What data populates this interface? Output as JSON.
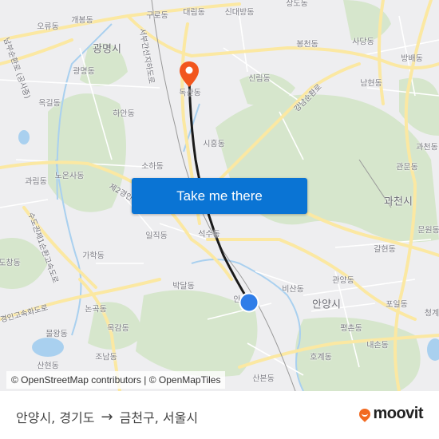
{
  "map": {
    "colors": {
      "background": "#eeeef0",
      "park": "#d6e6cc",
      "major_road": "#fbe8a2",
      "minor_road": "#ffffff",
      "water": "#a9d0ef",
      "route_line": "#1a1a1a",
      "destination_pin": "#f2561d",
      "origin_dot": "#2f7de8"
    },
    "labels": [
      {
        "text": "개봉동",
        "type": "district"
      },
      {
        "text": "오류동",
        "type": "district"
      },
      {
        "text": "구로동",
        "type": "district"
      },
      {
        "text": "대림동",
        "type": "district"
      },
      {
        "text": "신대방동",
        "type": "district"
      },
      {
        "text": "상도동",
        "type": "district"
      },
      {
        "text": "광명시",
        "type": "city"
      },
      {
        "text": "광명동",
        "type": "district"
      },
      {
        "text": "옥길동",
        "type": "district"
      },
      {
        "text": "하안동",
        "type": "district"
      },
      {
        "text": "봉천동",
        "type": "district"
      },
      {
        "text": "사당동",
        "type": "district"
      },
      {
        "text": "방배동",
        "type": "district"
      },
      {
        "text": "신림동",
        "type": "district"
      },
      {
        "text": "남현동",
        "type": "district"
      },
      {
        "text": "독산동",
        "type": "district"
      },
      {
        "text": "시흥동",
        "type": "district"
      },
      {
        "text": "소하동",
        "type": "district"
      },
      {
        "text": "노온사동",
        "type": "district"
      },
      {
        "text": "과림동",
        "type": "district"
      },
      {
        "text": "과천동",
        "type": "district"
      },
      {
        "text": "관문동",
        "type": "district"
      },
      {
        "text": "과천시",
        "type": "city"
      },
      {
        "text": "문원동",
        "type": "district"
      },
      {
        "text": "갈현동",
        "type": "district"
      },
      {
        "text": "일직동",
        "type": "district"
      },
      {
        "text": "석수동",
        "type": "district"
      },
      {
        "text": "가학동",
        "type": "district"
      },
      {
        "text": "도창동",
        "type": "district"
      },
      {
        "text": "박달동",
        "type": "district"
      },
      {
        "text": "비산동",
        "type": "district"
      },
      {
        "text": "관양동",
        "type": "district"
      },
      {
        "text": "안양시",
        "type": "city"
      },
      {
        "text": "포일동",
        "type": "district"
      },
      {
        "text": "평촌동",
        "type": "district"
      },
      {
        "text": "내손동",
        "type": "district"
      },
      {
        "text": "호계동",
        "type": "district"
      },
      {
        "text": "청계",
        "type": "district"
      },
      {
        "text": "논곡동",
        "type": "district"
      },
      {
        "text": "목감동",
        "type": "district"
      },
      {
        "text": "물왕동",
        "type": "district"
      },
      {
        "text": "조남동",
        "type": "district"
      },
      {
        "text": "산현동",
        "type": "district"
      },
      {
        "text": "산본동",
        "type": "district"
      },
      {
        "text": "안",
        "type": "district"
      },
      {
        "text": "서부간선지하도로",
        "type": "road"
      },
      {
        "text": "강남순환로",
        "type": "road"
      },
      {
        "text": "제2경인",
        "type": "road"
      },
      {
        "text": "수도권제1순환고속도로",
        "type": "road"
      },
      {
        "text": "경인고속화도로",
        "type": "road"
      },
      {
        "text": "남부순환로 (공사중)",
        "type": "road"
      }
    ],
    "markers": {
      "origin": {
        "name": "안양시, 경기도",
        "icon": "origin-dot-icon"
      },
      "destination": {
        "name": "금천구, 서울시",
        "icon": "map-pin-icon"
      }
    }
  },
  "cta": {
    "label": "Take me there"
  },
  "attribution": {
    "text": "© OpenStreetMap contributors | © OpenMapTiles"
  },
  "footer": {
    "origin": "안양시, 경기도",
    "arrow": "→",
    "destination": "금천구, 서울시",
    "brand": "moovit"
  }
}
